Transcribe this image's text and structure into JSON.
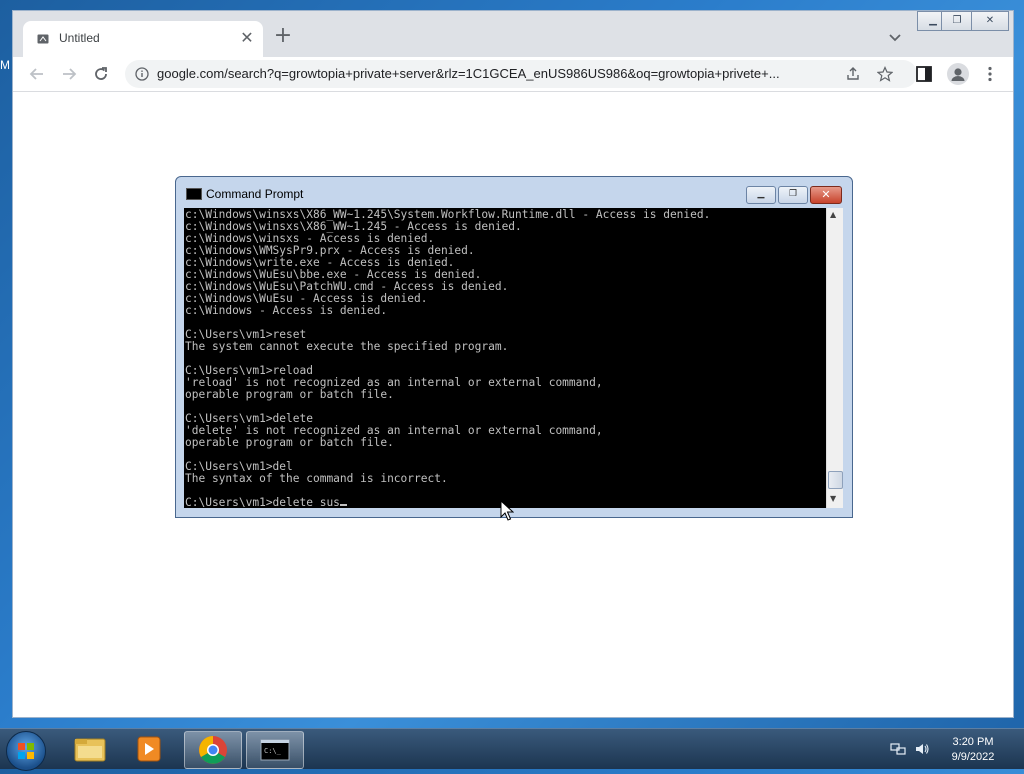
{
  "desktop": {
    "edge_text": "M"
  },
  "browser": {
    "tab_title": "Untitled",
    "new_tab_symbol": "+",
    "address_url": "google.com/search?q=growtopia+private+server&rlz=1C1GCEA_enUS986US986&oq=growtopia+privete+..."
  },
  "cmd": {
    "title": "Command Prompt",
    "lines": [
      "c:\\Windows\\winsxs\\X86_WW~1.245\\System.Workflow.Runtime.dll - Access is denied.",
      "c:\\Windows\\winsxs\\X86_WW~1.245 - Access is denied.",
      "c:\\Windows\\winsxs - Access is denied.",
      "c:\\Windows\\WMSysPr9.prx - Access is denied.",
      "c:\\Windows\\write.exe - Access is denied.",
      "c:\\Windows\\WuEsu\\bbe.exe - Access is denied.",
      "c:\\Windows\\WuEsu\\PatchWU.cmd - Access is denied.",
      "c:\\Windows\\WuEsu - Access is denied.",
      "c:\\Windows - Access is denied.",
      "",
      "C:\\Users\\vm1>reset",
      "The system cannot execute the specified program.",
      "",
      "C:\\Users\\vm1>reload",
      "'reload' is not recognized as an internal or external command,",
      "operable program or batch file.",
      "",
      "C:\\Users\\vm1>delete",
      "'delete' is not recognized as an internal or external command,",
      "operable program or batch file.",
      "",
      "C:\\Users\\vm1>del",
      "The syntax of the command is incorrect.",
      ""
    ],
    "prompt_line": "C:\\Users\\vm1>delete sus"
  },
  "taskbar": {
    "apps": [
      {
        "name": "windows-explorer",
        "active": false
      },
      {
        "name": "windows-media-player",
        "active": false
      },
      {
        "name": "google-chrome",
        "active": true
      },
      {
        "name": "command-prompt",
        "active": true
      }
    ],
    "time": "3:20 PM",
    "date": "9/9/2022"
  },
  "colors": {
    "console_bg": "#000000",
    "console_fg": "#c0c0c0",
    "taskbar": "#22405f",
    "chrome_tabstrip": "#dee1e6"
  }
}
